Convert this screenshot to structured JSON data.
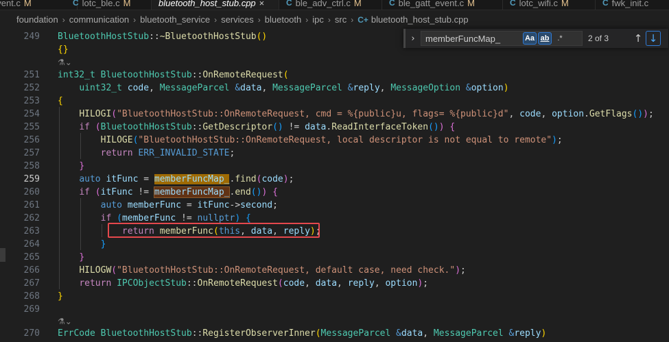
{
  "tabs": [
    {
      "name": "event.c",
      "modified": "M"
    },
    {
      "name": "lotc_ble.c",
      "modified": "M"
    },
    {
      "name": "bluetooth_host_stub.cpp",
      "modified": "",
      "active": true
    },
    {
      "name": "ble_adv_ctrl.c",
      "modified": "M"
    },
    {
      "name": "ble_gatt_event.c",
      "modified": "M"
    },
    {
      "name": "lotc_wifi.c",
      "modified": "M"
    },
    {
      "name": "fwk_init.c",
      "modified": ""
    }
  ],
  "breadcrumb": [
    "foundation",
    "communication",
    "bluetooth_service",
    "services",
    "bluetooth",
    "ipc",
    "src",
    "bluetooth_host_stub.cpp"
  ],
  "find": {
    "query": "memberFuncMap_",
    "match_case": "Aa",
    "whole_word": "ab",
    "regex": ".*",
    "count": "2 of 3"
  },
  "line_numbers": [
    "249",
    "",
    "",
    "251",
    "252",
    "253",
    "254",
    "255",
    "256",
    "257",
    "258",
    "259",
    "260",
    "261",
    "262",
    "263",
    "264",
    "265",
    "266",
    "267",
    "268",
    "269",
    "",
    "270"
  ],
  "active_line": "259",
  "colors": {
    "highlight_box": "#e5484d",
    "match_bg": "#613214",
    "current_match_bg": "#9e6a03"
  }
}
